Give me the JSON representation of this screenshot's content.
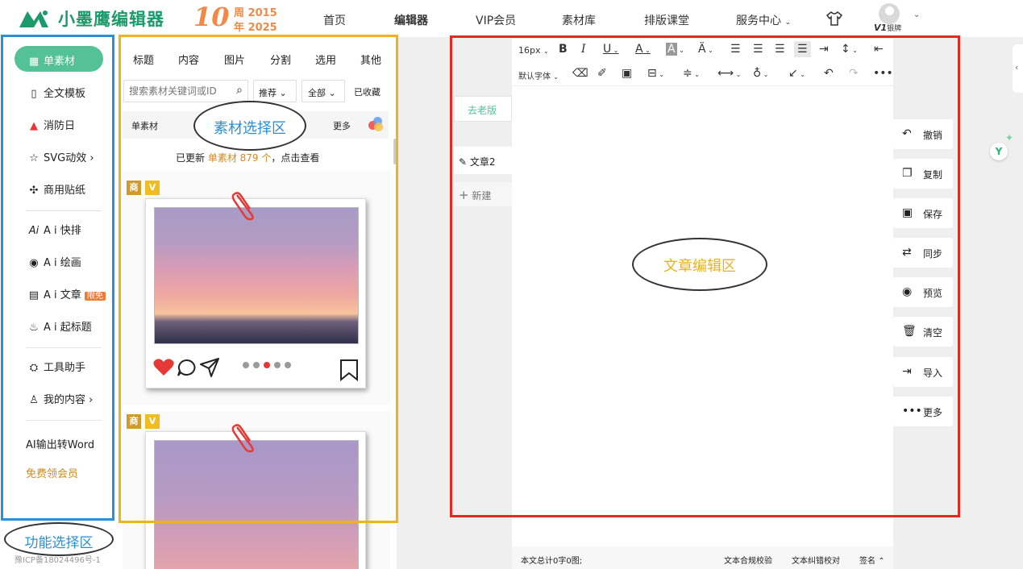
{
  "header": {
    "brand": "小墨鹰编辑器",
    "anniv_num": "10",
    "anniv_year1": "周 2015",
    "anniv_year2": "年 2025",
    "nav": [
      "首页",
      "编辑器",
      "VIP会员",
      "素材库",
      "排版课堂",
      "服务中心"
    ],
    "vip_badge": "V1",
    "vip_label": "银牌",
    "icons": [
      "shirt-icon",
      "avatar-icon"
    ]
  },
  "sidebar": {
    "items": [
      {
        "label": "单素材",
        "icon": "grid-icon",
        "active": true
      },
      {
        "label": "全文模板",
        "icon": "template-icon"
      },
      {
        "label": "消防日",
        "icon": "siren-icon"
      },
      {
        "label": "SVG动效",
        "icon": "star-icon"
      },
      {
        "label": "商用贴纸",
        "icon": "puzzle-icon"
      },
      {
        "label": "A i 快排",
        "icon": "ai-icon"
      },
      {
        "label": "A i 绘画",
        "icon": "palette-icon"
      },
      {
        "label": "A i 文章",
        "icon": "doc-icon",
        "badge": "限免"
      },
      {
        "label": "A i 起标题",
        "icon": "flame-icon"
      },
      {
        "label": "工具助手",
        "icon": "tool-icon"
      },
      {
        "label": "我的内容",
        "icon": "user-icon"
      }
    ],
    "word_link": "AI输出转Word",
    "free_vip": "免费领会员",
    "icp": "豫ICP备18024496号-1",
    "accent": "#54c197"
  },
  "materials": {
    "tabs": [
      "标题",
      "内容",
      "图片",
      "分割",
      "选用",
      "其他"
    ],
    "search_placeholder": "搜索素材关键词或ID",
    "sort": "推荐",
    "filter": "全部",
    "favorites": "已收藏",
    "sub_label": "单素材",
    "more": "更多",
    "update_prefix": "已更新 ",
    "update_link": "单素材 879 个",
    "update_suffix": "，点击查看",
    "badges": [
      "商",
      "V"
    ]
  },
  "editor": {
    "font_size": "16px",
    "font_family": "默认字体",
    "old_version": "去老版",
    "doc_name": "文章2",
    "new_doc": "新建",
    "word_count": "本文总计0字0图;",
    "compliance": "文本合规校验",
    "proofread": "文本纠错校对",
    "signature": "签名"
  },
  "side_actions": [
    "撤销",
    "复制",
    "保存",
    "同步",
    "预览",
    "清空",
    "导入",
    "更多"
  ],
  "callouts": {
    "function": "功能选择区",
    "material": "素材选择区",
    "article": "文章编辑区"
  },
  "colors": {
    "blue_frame": "#2b8fd6",
    "yellow_frame": "#f2b21c",
    "red_frame": "#e02a22",
    "callout_blue": "#2b8fd6",
    "callout_yellow": "#e6b422"
  }
}
